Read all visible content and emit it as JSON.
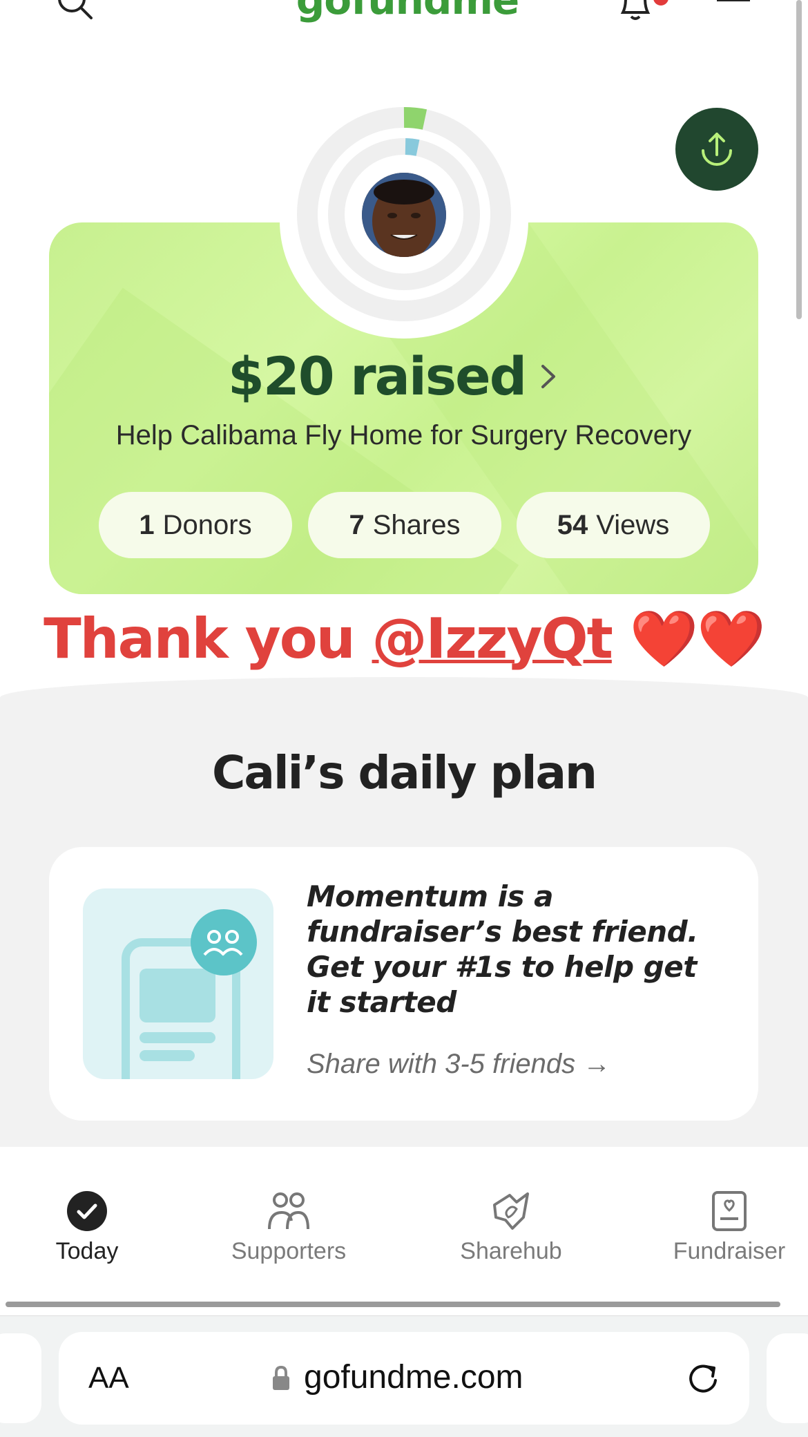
{
  "header": {
    "logo_text": "gofundme",
    "icons": [
      "search-icon",
      "bell-icon",
      "menu-icon"
    ]
  },
  "fundraiser": {
    "raised_label": "$20 raised",
    "title": "Help Calibama Fly Home for Surgery Recovery",
    "stats": [
      {
        "value": "1",
        "label": "Donors"
      },
      {
        "value": "7",
        "label": "Shares"
      },
      {
        "value": "54",
        "label": "Views"
      }
    ]
  },
  "overlay": {
    "thanks_prefix": "Thank you ",
    "mention": "@IzzyQt",
    "hearts": "❤️❤️"
  },
  "plan": {
    "title": "Cali’s daily plan",
    "card_text": "Momentum is a fundraiser’s best friend. Get your #1s to help get it started",
    "card_link": "Share with 3-5 friends →"
  },
  "nav": {
    "items": [
      {
        "label": "Today",
        "icon": "check-circle-icon",
        "active": true
      },
      {
        "label": "Supporters",
        "icon": "people-icon",
        "active": false
      },
      {
        "label": "Sharehub",
        "icon": "sharehub-icon",
        "active": false
      },
      {
        "label": "Fundraiser",
        "icon": "fundraiser-icon",
        "active": false
      }
    ]
  },
  "browser": {
    "text_size_label": "AA",
    "url": "gofundme.com"
  },
  "colors": {
    "brand_green": "#3b9c3a",
    "dark_green": "#1f4d2b",
    "card_green": "#d3f59f",
    "thanks_red": "#e0423d"
  }
}
